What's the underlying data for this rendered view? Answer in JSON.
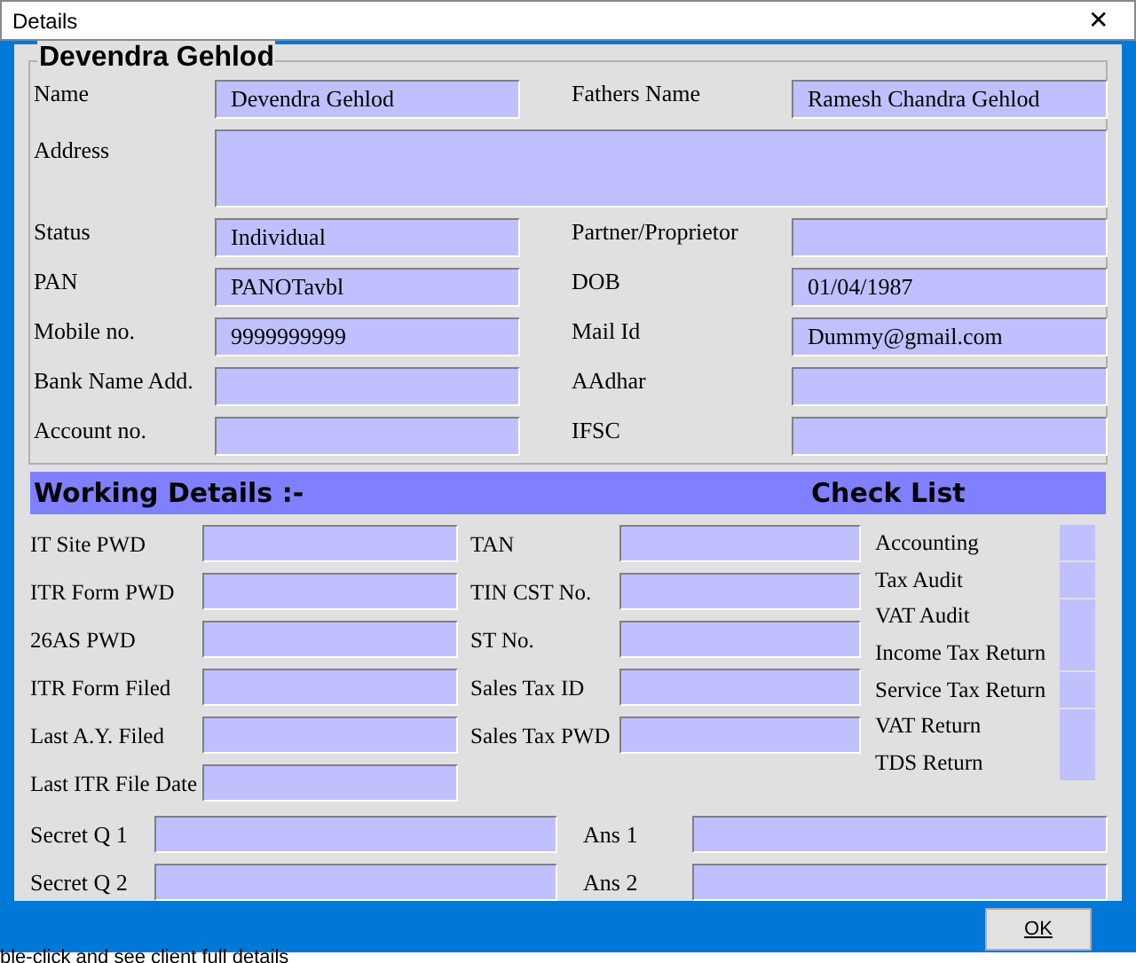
{
  "window": {
    "title": "Details",
    "close": "✕"
  },
  "client": {
    "heading": "Devendra Gehlod",
    "fields": [
      {
        "label": "Name",
        "value": "Devendra Gehlod",
        "kind": "single"
      },
      {
        "label": "Fathers Name",
        "value": "Ramesh Chandra Gehlod",
        "kind": "single"
      },
      {
        "label": "Address",
        "kind": "wide"
      },
      {
        "label": "Status",
        "value": "Individual",
        "kind": "single"
      },
      {
        "label": "Partner/Proprietor",
        "kind": "single"
      },
      {
        "label": "PAN",
        "value": "PANOTavbl",
        "kind": "single"
      },
      {
        "label": "DOB",
        "value": "01/04/1987",
        "kind": "single"
      },
      {
        "label": "Mobile no.",
        "value": "9999999999",
        "kind": "single"
      },
      {
        "label": "Mail Id",
        "value": "Dummy@gmail.com",
        "kind": "single"
      },
      {
        "label": "Bank Name Add.",
        "kind": "single"
      },
      {
        "label": "AAdhar",
        "kind": "single"
      },
      {
        "label": "Account no.",
        "kind": "single"
      },
      {
        "label": "IFSC",
        "kind": "single"
      }
    ]
  },
  "working": {
    "heading": "Working Details :-",
    "checklist_heading": "Check List",
    "column_1": [
      {
        "label": "IT Site PWD"
      },
      {
        "label": "ITR Form PWD"
      },
      {
        "label": "26AS PWD"
      },
      {
        "label": "ITR Form Filed"
      },
      {
        "label": "Last A.Y. Filed"
      },
      {
        "label": "Last ITR File Date"
      }
    ],
    "column_2": [
      {
        "label": "TAN"
      },
      {
        "label": "TIN CST No."
      },
      {
        "label": "ST No."
      },
      {
        "label": "Sales Tax ID"
      },
      {
        "label": "Sales Tax PWD"
      }
    ],
    "checklist": [
      {
        "label": "Accounting",
        "checked": false
      },
      {
        "label": "Tax Audit",
        "checked": false
      },
      {
        "label": "VAT Audit",
        "checked": false
      },
      {
        "label": "Income Tax Return",
        "checked": false
      },
      {
        "label": "Service Tax Return",
        "checked": false
      },
      {
        "label": "VAT Return",
        "checked": false
      },
      {
        "label": "TDS Return",
        "checked": false
      }
    ]
  },
  "secrets": [
    {
      "question": "Secret Q 1",
      "answer": "Ans 1"
    },
    {
      "question": "Secret Q 2",
      "answer": "Ans 2"
    }
  ],
  "ok_button": {
    "label": "OK"
  },
  "status_text": "ble-click and see client full details"
}
